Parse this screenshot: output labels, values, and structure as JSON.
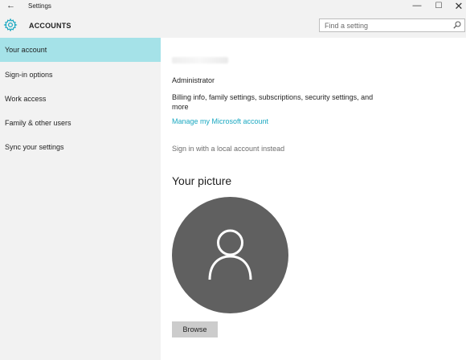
{
  "window": {
    "title": "Settings",
    "back_glyph": "←",
    "min_glyph": "—",
    "max_glyph": "☐",
    "close_glyph": "✕"
  },
  "header": {
    "section": "ACCOUNTS",
    "icon": "gear-icon",
    "accent_color": "#1aa8c1"
  },
  "search": {
    "placeholder": "Find a setting",
    "value": "",
    "icon": "search-icon"
  },
  "sidebar": {
    "items": [
      {
        "label": "Your account",
        "active": true
      },
      {
        "label": "Sign-in options",
        "active": false
      },
      {
        "label": "Work access",
        "active": false
      },
      {
        "label": "Family & other users",
        "active": false
      },
      {
        "label": "Sync your settings",
        "active": false
      }
    ],
    "active_color": "#a5e2e8"
  },
  "account": {
    "role": "Administrator",
    "description": "Billing info, family settings, subscriptions, security settings, and more",
    "manage_link": "Manage my Microsoft account",
    "local_link": "Sign in with a local account instead"
  },
  "picture": {
    "title": "Your picture",
    "avatar_icon": "person-icon",
    "avatar_color": "#606060",
    "browse_label": "Browse"
  }
}
